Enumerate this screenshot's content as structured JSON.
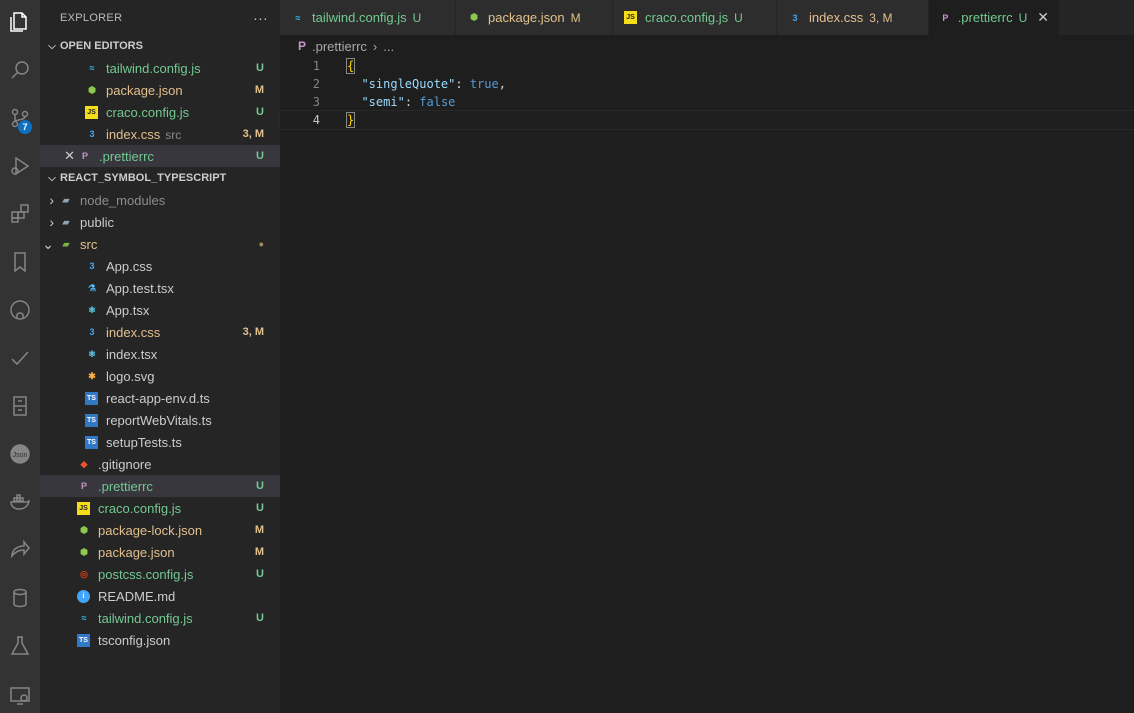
{
  "activity_bar": {
    "icons": [
      "explorer-icon",
      "search-icon",
      "source-control-icon",
      "run-debug-icon",
      "extensions-icon",
      "bookmarks-icon",
      "github-icon",
      "todo-check-icon",
      "remote-explorer-icon",
      "json-icon",
      "docker-icon",
      "live-share-icon",
      "database-icon",
      "testing-icon",
      "remote-window-icon"
    ],
    "source_control_badge": "7"
  },
  "sidebar": {
    "title": "EXPLORER",
    "more": "···",
    "open_editors": {
      "label": "OPEN EDITORS",
      "items": [
        {
          "name": "tailwind.config.js",
          "icon": "tailwind",
          "status": "U",
          "color": "#73c991"
        },
        {
          "name": "package.json",
          "icon": "nodejs",
          "status": "M",
          "color": "#e2c08d"
        },
        {
          "name": "craco.config.js",
          "icon": "js",
          "status": "U",
          "color": "#73c991"
        },
        {
          "name": "index.css",
          "icon": "css",
          "sub": "src",
          "status": "3, M",
          "color": "#e2c08d"
        },
        {
          "name": ".prettierrc",
          "icon": "prettier",
          "status": "U",
          "color": "#73c991",
          "close": "✕"
        }
      ]
    },
    "project": {
      "label": "REACT_SYMBOL_TYPESCRIPT",
      "items": [
        {
          "name": "node_modules",
          "type": "folder"
        },
        {
          "name": "public",
          "type": "folder"
        },
        {
          "name": "src",
          "type": "folder-open",
          "status": "●"
        },
        {
          "name": "App.css",
          "icon": "css"
        },
        {
          "name": "App.test.tsx",
          "icon": "test"
        },
        {
          "name": "App.tsx",
          "icon": "react"
        },
        {
          "name": "index.css",
          "icon": "css",
          "status": "3, M"
        },
        {
          "name": "index.tsx",
          "icon": "react"
        },
        {
          "name": "logo.svg",
          "icon": "svg"
        },
        {
          "name": "react-app-env.d.ts",
          "icon": "ts"
        },
        {
          "name": "reportWebVitals.ts",
          "icon": "ts"
        },
        {
          "name": "setupTests.ts",
          "icon": "ts"
        },
        {
          "name": ".gitignore",
          "icon": "git"
        },
        {
          "name": ".prettierrc",
          "icon": "prettier",
          "status": "U"
        },
        {
          "name": "craco.config.js",
          "icon": "js",
          "status": "U"
        },
        {
          "name": "package-lock.json",
          "icon": "nodejs",
          "status": "M"
        },
        {
          "name": "package.json",
          "icon": "nodejs",
          "status": "M"
        },
        {
          "name": "postcss.config.js",
          "icon": "postcss",
          "status": "U"
        },
        {
          "name": "README.md",
          "icon": "info"
        },
        {
          "name": "tailwind.config.js",
          "icon": "tailwind",
          "status": "U"
        },
        {
          "name": "tsconfig.json",
          "icon": "tsconfig"
        }
      ]
    }
  },
  "tabs": [
    {
      "name": "tailwind.config.js",
      "icon": "tailwind",
      "status": "U"
    },
    {
      "name": "package.json",
      "icon": "nodejs",
      "status": "M"
    },
    {
      "name": "craco.config.js",
      "icon": "js",
      "status": "U"
    },
    {
      "name": "index.css",
      "icon": "css",
      "status": "3, M"
    },
    {
      "name": ".prettierrc",
      "icon": "prettier",
      "status": "U",
      "close": "✕"
    }
  ],
  "breadcrumb": {
    "file": ".prettierrc",
    "sep": "›",
    "rest": "..."
  },
  "editor": {
    "lines": [
      {
        "num": "1",
        "code": "{"
      },
      {
        "num": "2",
        "code": "  \"singleQuote\": true,"
      },
      {
        "num": "3",
        "code": "  \"semi\": false"
      },
      {
        "num": "4",
        "code": "}"
      }
    ]
  },
  "colors": {
    "untracked": "#73c991",
    "modified": "#e2c08d",
    "accent": "#0e70c0",
    "string_key": "#9cdcfe",
    "boolean": "#569cd6",
    "bracket": "#ffd700"
  }
}
